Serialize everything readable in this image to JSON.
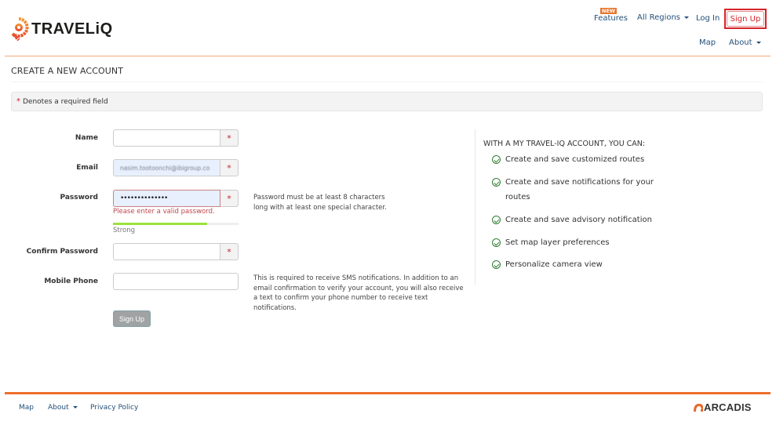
{
  "header": {
    "logo_text": "TRAVELiQ",
    "nav_top": {
      "new_badge": "NEW",
      "features": "Features",
      "all_regions": "All Regions",
      "log_in": "Log In",
      "sign_up": "Sign Up"
    },
    "nav_secondary": {
      "map": "Map",
      "about": "About"
    }
  },
  "page": {
    "title": "CREATE A NEW ACCOUNT",
    "required_notice": {
      "star": "*",
      "text": "Denotes a required field"
    }
  },
  "form": {
    "name": {
      "label": "Name",
      "value": "",
      "required": true
    },
    "email": {
      "label": "Email",
      "value": "nasim.tootoonchi@ibigroup.co",
      "required": true
    },
    "password": {
      "label": "Password",
      "value": "••••••••••••••",
      "required": true,
      "error": "Please enter a valid password.",
      "strength_label": "Strong",
      "strength_percent": 75,
      "help": "Password must be at least 8 characters long with at least one special character."
    },
    "confirm_password": {
      "label": "Confirm Password",
      "value": "",
      "required": true
    },
    "mobile_phone": {
      "label": "Mobile Phone",
      "value": "",
      "required": false,
      "help": "This is required to receive SMS notifications. In addition to an email confirmation to verify your account, you will also receive a text to confirm your phone number to receive text notifications."
    },
    "required_marker": "*",
    "submit_label": "Sign Up"
  },
  "benefits": {
    "title": "WITH A MY TRAVEL-IQ ACCOUNT, YOU CAN:",
    "items": [
      "Create and save customized routes",
      "Create and save notifications for your routes",
      "Create and save advisory notification",
      "Set map layer preferences",
      "Personalize camera view"
    ]
  },
  "footer": {
    "links": {
      "map": "Map",
      "about": "About",
      "privacy": "Privacy Policy"
    },
    "brand": "ARCADIS"
  },
  "colors": {
    "accent": "#ed6f2c",
    "link": "#23507a",
    "required": "#c0272d",
    "success": "#2e7d32",
    "strength": "#9be23c"
  }
}
